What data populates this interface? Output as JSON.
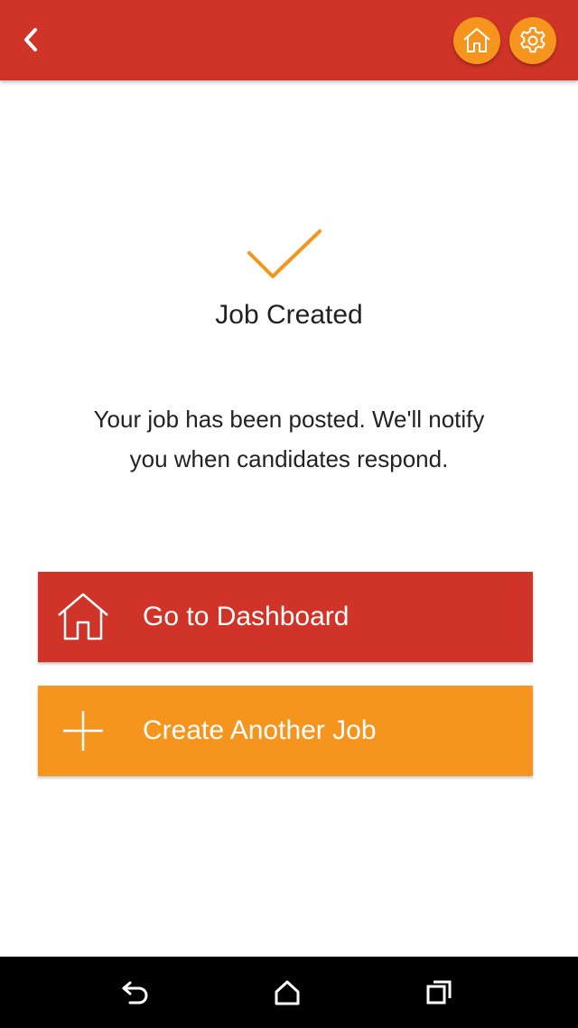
{
  "header": {
    "back_icon": "chevron-left-icon",
    "home_icon": "home-icon",
    "settings_icon": "gear-icon",
    "bar_color": "#d03327",
    "button_color": "#f6951e"
  },
  "status": {
    "icon": "checkmark-icon",
    "title": "Job Created",
    "message": "Your job has been posted. We'll notify you when candidates respond."
  },
  "actions": {
    "dashboard": {
      "label": "Go to Dashboard",
      "icon": "home-icon",
      "color": "#d03327"
    },
    "create": {
      "label": "Create Another Job",
      "icon": "plus-icon",
      "color": "#f6951e"
    }
  },
  "system_nav": {
    "back_icon": "back-arrow-icon",
    "home_icon": "home-outline-icon",
    "recents_icon": "recents-icon"
  }
}
